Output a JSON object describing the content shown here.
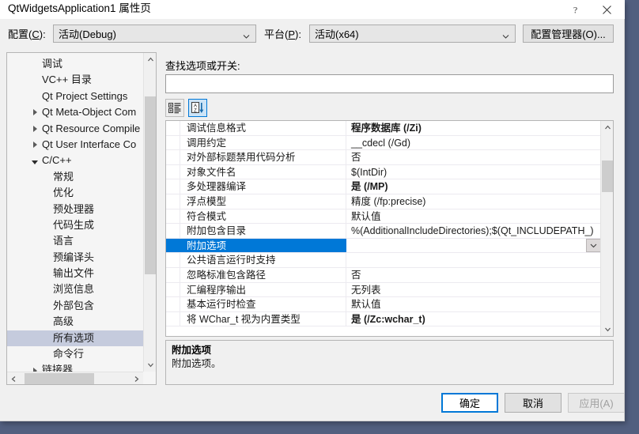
{
  "window": {
    "title": "QtWidgetsApplication1 属性页",
    "help_icon": "question-mark-icon",
    "close_icon": "close-icon"
  },
  "config_bar": {
    "config_label": "配置(C):",
    "config_label_plain": "配置",
    "config_value": "活动(Debug)",
    "platform_label": "平台(P):",
    "platform_value": "活动(x64)",
    "config_manager_button": "配置管理器(O)..."
  },
  "tree": {
    "items": [
      {
        "label": "调试",
        "indent": 1,
        "expander": "none",
        "selected": false
      },
      {
        "label": "VC++ 目录",
        "indent": 1,
        "expander": "none",
        "selected": false
      },
      {
        "label": "Qt Project Settings",
        "indent": 1,
        "expander": "none",
        "selected": false
      },
      {
        "label": "Qt Meta-Object Com",
        "indent": 1,
        "expander": "closed",
        "selected": false
      },
      {
        "label": "Qt Resource Compile",
        "indent": 1,
        "expander": "closed",
        "selected": false
      },
      {
        "label": "Qt User Interface Co",
        "indent": 1,
        "expander": "closed",
        "selected": false
      },
      {
        "label": "C/C++",
        "indent": 1,
        "expander": "open",
        "selected": false
      },
      {
        "label": "常规",
        "indent": 2,
        "expander": "none",
        "selected": false
      },
      {
        "label": "优化",
        "indent": 2,
        "expander": "none",
        "selected": false
      },
      {
        "label": "预处理器",
        "indent": 2,
        "expander": "none",
        "selected": false
      },
      {
        "label": "代码生成",
        "indent": 2,
        "expander": "none",
        "selected": false
      },
      {
        "label": "语言",
        "indent": 2,
        "expander": "none",
        "selected": false
      },
      {
        "label": "预编译头",
        "indent": 2,
        "expander": "none",
        "selected": false
      },
      {
        "label": "输出文件",
        "indent": 2,
        "expander": "none",
        "selected": false
      },
      {
        "label": "浏览信息",
        "indent": 2,
        "expander": "none",
        "selected": false
      },
      {
        "label": "外部包含",
        "indent": 2,
        "expander": "none",
        "selected": false
      },
      {
        "label": "高级",
        "indent": 2,
        "expander": "none",
        "selected": false
      },
      {
        "label": "所有选项",
        "indent": 2,
        "expander": "none",
        "selected": true
      },
      {
        "label": "命令行",
        "indent": 2,
        "expander": "none",
        "selected": false
      },
      {
        "label": "链接器",
        "indent": 1,
        "expander": "closed",
        "selected": false
      }
    ]
  },
  "search": {
    "label": "查找选项或开关:",
    "value": "",
    "placeholder": ""
  },
  "grid_toolbar": {
    "categorized_icon": "categorized-view-icon",
    "alphabetic_icon": "sort-alphabetical-icon"
  },
  "grid": {
    "rows": [
      {
        "name": "调试信息格式",
        "value": "程序数据库 (/Zi)",
        "bold": true,
        "selected": false
      },
      {
        "name": "调用约定",
        "value": "__cdecl (/Gd)",
        "bold": false,
        "selected": false
      },
      {
        "name": "对外部标题禁用代码分析",
        "value": "否",
        "bold": false,
        "selected": false
      },
      {
        "name": "对象文件名",
        "value": "$(IntDir)",
        "bold": false,
        "selected": false
      },
      {
        "name": "多处理器编译",
        "value": "是 (/MP)",
        "bold": true,
        "selected": false
      },
      {
        "name": "浮点模型",
        "value": "精度 (/fp:precise)",
        "bold": false,
        "selected": false
      },
      {
        "name": "符合模式",
        "value": "默认值",
        "bold": false,
        "selected": false
      },
      {
        "name": "附加包含目录",
        "value": "%(AdditionalIncludeDirectories);$(Qt_INCLUDEPATH_)",
        "bold": false,
        "selected": false
      },
      {
        "name": "附加选项",
        "value": "",
        "bold": false,
        "selected": true
      },
      {
        "name": "公共语言运行时支持",
        "value": "",
        "bold": false,
        "selected": false
      },
      {
        "name": "忽略标准包含路径",
        "value": "否",
        "bold": false,
        "selected": false
      },
      {
        "name": "汇编程序输出",
        "value": "无列表",
        "bold": false,
        "selected": false
      },
      {
        "name": "基本运行时检查",
        "value": "默认值",
        "bold": false,
        "selected": false
      },
      {
        "name": "将 WChar_t 视为内置类型",
        "value": "是 (/Zc:wchar_t)",
        "bold": true,
        "selected": false
      }
    ]
  },
  "description": {
    "title": "附加选项",
    "body": "附加选项。"
  },
  "footer": {
    "ok": "确定",
    "cancel": "取消",
    "apply": "应用(A)"
  },
  "colors": {
    "accent": "#0078d7",
    "selection": "#0078d7",
    "tree_selection": "#c5cbdd",
    "dialog_bg": "#f0f0f0",
    "desktop": "#525f7f"
  }
}
